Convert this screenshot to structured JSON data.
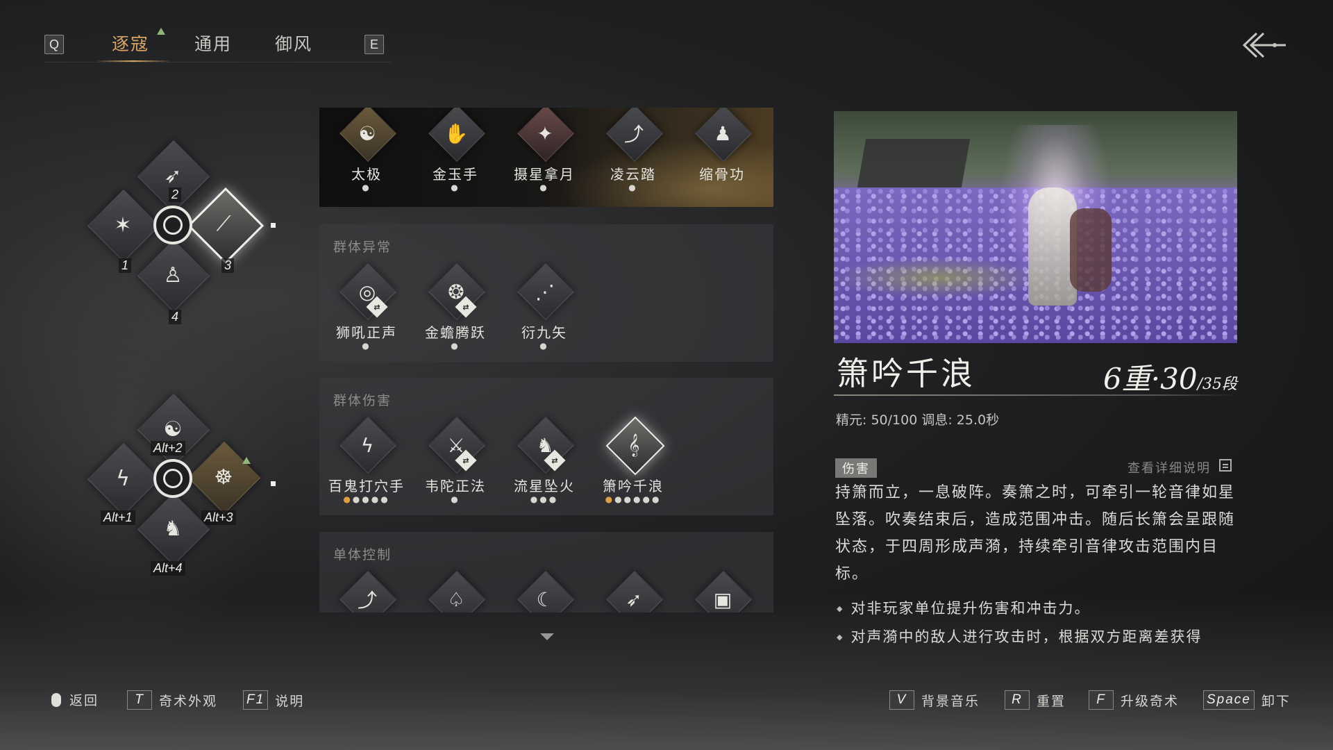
{
  "tabs": {
    "left_key": "Q",
    "right_key": "E",
    "items": [
      {
        "label": "逐寇",
        "active": true
      },
      {
        "label": "通用",
        "active": false
      },
      {
        "label": "御风",
        "active": false
      }
    ]
  },
  "wheel_top": {
    "slots": [
      {
        "num": "2",
        "icon": "spear-icon"
      },
      {
        "num": "1",
        "icon": "claw-icon"
      },
      {
        "num": "3",
        "icon": "flute-icon",
        "selected": true
      },
      {
        "num": "4",
        "icon": "figure-icon"
      }
    ]
  },
  "wheel_bottom": {
    "slots": [
      {
        "num": "Alt+2",
        "icon": "yinyang-icon"
      },
      {
        "num": "Alt+1",
        "icon": "lightning-icon"
      },
      {
        "num": "Alt+3",
        "icon": "taiji-icon",
        "upgradable": true
      },
      {
        "num": "Alt+4",
        "icon": "horse-icon"
      }
    ]
  },
  "skills": {
    "featured": [
      {
        "name": "太极",
        "icon": "taiji-icon",
        "glyph": "☯"
      },
      {
        "name": "金玉手",
        "icon": "palm-icon",
        "glyph": "✋"
      },
      {
        "name": "摄星拿月",
        "icon": "grasp-icon",
        "glyph": "✦"
      },
      {
        "name": "凌云踏",
        "icon": "kick-icon",
        "glyph": "⤴"
      },
      {
        "name": "缩骨功",
        "icon": "monk-icon",
        "glyph": "♟"
      }
    ],
    "group_control": {
      "title": "群体异常",
      "items": [
        {
          "name": "狮吼正声",
          "icon": "roar-icon",
          "glyph": "◎"
        },
        {
          "name": "金蟾腾跃",
          "icon": "toad-icon",
          "glyph": "❂"
        },
        {
          "name": "衍九矢",
          "icon": "arrows-icon",
          "glyph": "⋰"
        }
      ]
    },
    "group_damage": {
      "title": "群体伤害",
      "items": [
        {
          "name": "百鬼打穴手",
          "icon": "lightning-icon",
          "glyph": "ϟ",
          "dots": "●●●●",
          "gold_dots": 1
        },
        {
          "name": "韦陀正法",
          "icon": "staff-icon",
          "glyph": "⚔",
          "dots": "●"
        },
        {
          "name": "流星坠火",
          "icon": "horse-icon",
          "glyph": "♞",
          "dots": "●●●"
        },
        {
          "name": "箫吟千浪",
          "icon": "flute-icon",
          "glyph": "𝄞",
          "dots": "●●●●●",
          "gold_dots": 1
        }
      ]
    },
    "single_control": {
      "title": "单体控制"
    }
  },
  "detail": {
    "name": "箫吟千浪",
    "level_big": "6重·30",
    "level_small": "/35段",
    "stats": "精元: 50/100   调息: 25.0秒",
    "tag": "伤害",
    "detail_link": "查看详细说明",
    "description": "持箫而立，一息破阵。奏箫之时，可牵引一轮音律如星坠落。吹奏结束后，造成范围冲击。随后长箫会呈跟随状态，于四周形成声漪，持续牵引音律攻击范围内目标。",
    "bullets": [
      "对非玩家单位提升伤害和冲击力。",
      "对声漪中的敌人进行攻击时，根据双方距离差获得"
    ]
  },
  "bottom_hints": {
    "back": "返回",
    "appearance_key": "T",
    "appearance": "奇术外观",
    "help_key": "F1",
    "help": "说明",
    "music_key": "V",
    "music": "背景音乐",
    "reset_key": "R",
    "reset": "重置",
    "upgrade_key": "F",
    "upgrade": "升级奇术",
    "unequip_key": "Space",
    "unequip": "卸下"
  },
  "colors": {
    "accent": "#d9a566",
    "upgrade_green": "#8fb87a"
  }
}
